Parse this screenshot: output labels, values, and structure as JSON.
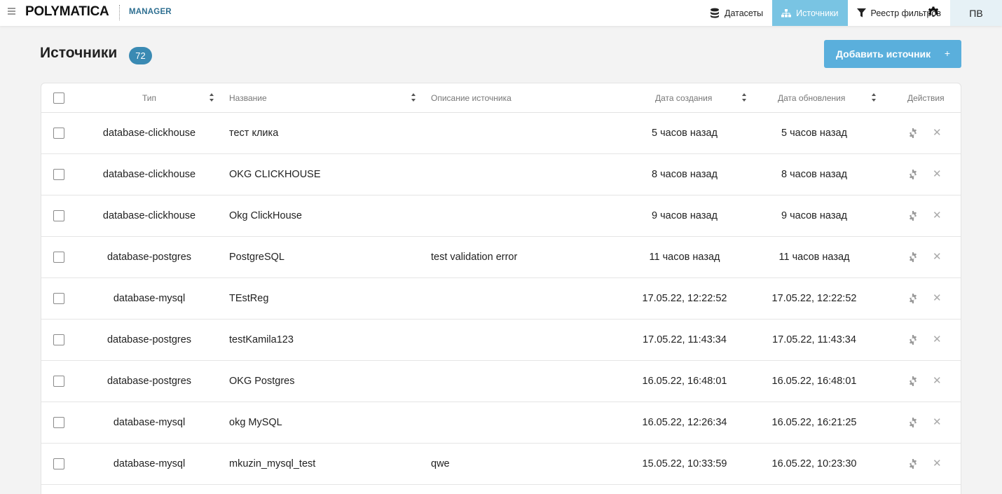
{
  "brand": {
    "logo": "POLYMATICA",
    "product": "MANAGER"
  },
  "nav": [
    {
      "label": "Датасеты",
      "icon": "database-icon",
      "active": false
    },
    {
      "label": "Источники",
      "icon": "sitemap-icon",
      "active": true
    },
    {
      "label": "Реестр фильтров",
      "icon": "filter-icon",
      "active": false
    }
  ],
  "user": {
    "initials": "ПВ"
  },
  "page": {
    "title": "Источники",
    "count": "72",
    "add_label": "Добавить источник",
    "add_plus": "+"
  },
  "columns": {
    "type": "Тип",
    "name": "Название",
    "description": "Описание источника",
    "created": "Дата создания",
    "updated": "Дата обновления",
    "actions": "Действия"
  },
  "rows": [
    {
      "type": "database-clickhouse",
      "name": "тест клика",
      "description": "",
      "created": "5 часов назад",
      "updated": "5 часов назад"
    },
    {
      "type": "database-clickhouse",
      "name": "OKG CLICKHOUSE",
      "description": "",
      "created": "8 часов назад",
      "updated": "8 часов назад"
    },
    {
      "type": "database-clickhouse",
      "name": "Okg ClickHouse",
      "description": "",
      "created": "9 часов назад",
      "updated": "9 часов назад"
    },
    {
      "type": "database-postgres",
      "name": "PostgreSQL",
      "description": "test validation error",
      "created": "11 часов назад",
      "updated": "11 часов назад"
    },
    {
      "type": "database-mysql",
      "name": "TEstReg",
      "description": "",
      "created": "17.05.22, 12:22:52",
      "updated": "17.05.22, 12:22:52"
    },
    {
      "type": "database-postgres",
      "name": "testKamila123",
      "description": "",
      "created": "17.05.22, 11:43:34",
      "updated": "17.05.22, 11:43:34"
    },
    {
      "type": "database-postgres",
      "name": "OKG Postgres",
      "description": "",
      "created": "16.05.22, 16:48:01",
      "updated": "16.05.22, 16:48:01"
    },
    {
      "type": "database-mysql",
      "name": "okg MySQL",
      "description": "",
      "created": "16.05.22, 12:26:34",
      "updated": "16.05.22, 16:21:25"
    },
    {
      "type": "database-mysql",
      "name": "mkuzin_mysql_test",
      "description": "qwe",
      "created": "15.05.22, 10:33:59",
      "updated": "16.05.22, 10:23:30"
    }
  ],
  "colors": {
    "accent": "#79c4e3",
    "button": "#5aafdc",
    "badge": "#3a8ab3",
    "brand_sub": "#2e6f91"
  }
}
